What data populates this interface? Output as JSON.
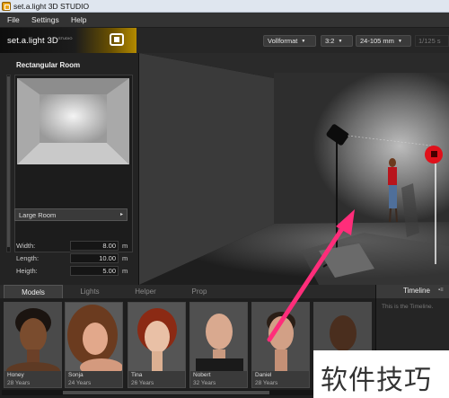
{
  "window": {
    "title": "set.a.light 3D STUDIO",
    "icon": "app-logo-icon"
  },
  "menu": {
    "items": [
      "File",
      "Settings",
      "Help"
    ]
  },
  "brand": {
    "name": "set.a.light 3D",
    "superscript": "STUDIO",
    "icon": "camera-frame-icon"
  },
  "toolbar": {
    "sensor_format": "Vollformat",
    "aspect_ratio": "3:2",
    "lens": "24-105 mm",
    "shutter_speed": "1/125 s"
  },
  "room_panel": {
    "title": "Rectangular Room",
    "room_size": "Large Room",
    "dimensions": [
      {
        "label": "Width:",
        "value": "8.00",
        "unit": "m"
      },
      {
        "label": "Length:",
        "value": "10.00",
        "unit": "m"
      },
      {
        "label": "Heigth:",
        "value": "5.00",
        "unit": "m"
      }
    ]
  },
  "bottom_tabs": [
    "Models",
    "Lights",
    "Helper",
    "Prop"
  ],
  "active_tab": "Models",
  "timeline": {
    "title": "Timeline",
    "text": "This is the Timeline."
  },
  "models": [
    {
      "name": "Honey",
      "age": "28 Years"
    },
    {
      "name": "Sonja",
      "age": "24 Years"
    },
    {
      "name": "Tina",
      "age": "26 Years"
    },
    {
      "name": "Nobert",
      "age": "32 Years"
    },
    {
      "name": "Daniel",
      "age": "28 Years"
    },
    {
      "name": "",
      "age": ""
    }
  ],
  "watermark": {
    "text": "软件技巧"
  },
  "colors": {
    "accent": "#b38a00",
    "annotation_arrow": "#ff2d7a",
    "light_red": "#e0101a"
  }
}
